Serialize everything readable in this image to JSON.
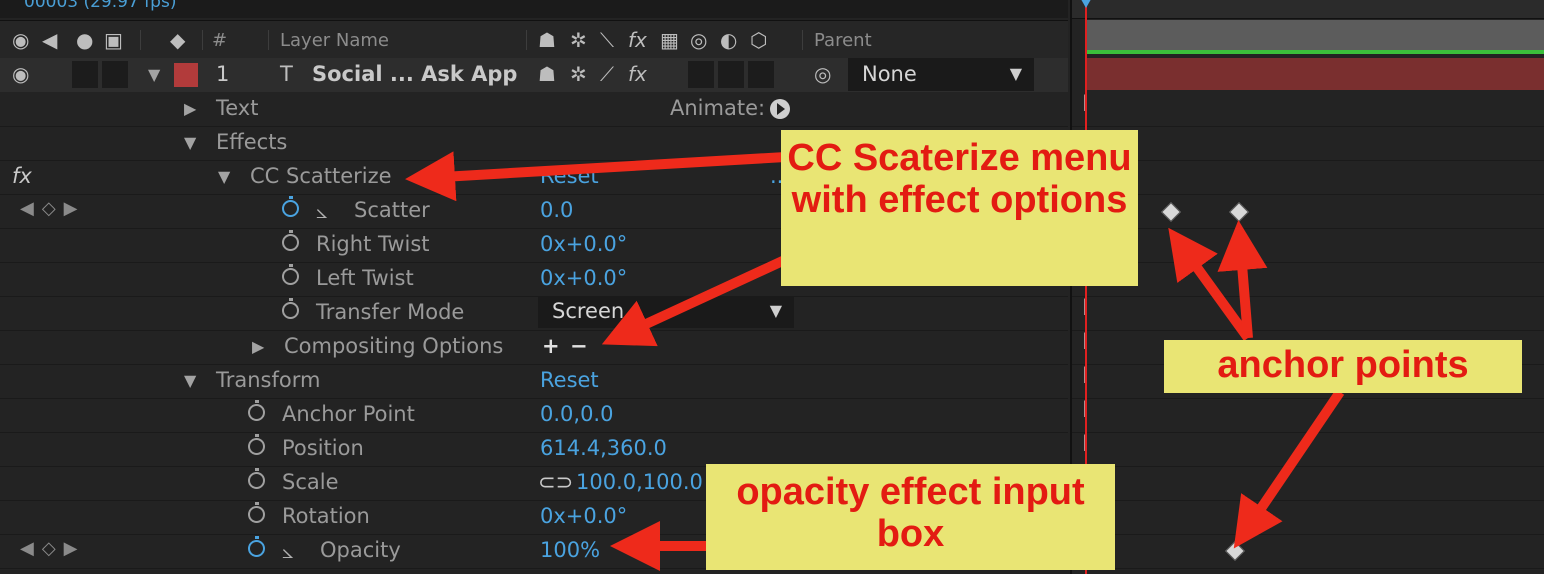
{
  "topbar": {
    "fps": "00003 (29.97 fps)"
  },
  "header": {
    "num_label": "#",
    "layer_name_label": "Layer Name",
    "parent_label": "Parent"
  },
  "layer": {
    "index": "1",
    "name": "Social ... Ask App",
    "color": "#b23b3b",
    "parent_value": "None"
  },
  "properties": {
    "text": "Text",
    "animate_label": "Animate:",
    "effects": "Effects",
    "fx_badge": "fx",
    "cc_scatterize": "CC Scatterize",
    "cc_reset": "Reset",
    "cc_more": "...",
    "scatter": {
      "label": "Scatter",
      "value": "0.0"
    },
    "right_twist": {
      "label": "Right Twist",
      "value": "0x+0.0°"
    },
    "left_twist": {
      "label": "Left Twist",
      "value": "0x+0.0°"
    },
    "transfer_mode": {
      "label": "Transfer Mode",
      "value": "Screen"
    },
    "compositing": {
      "label": "Compositing Options",
      "plus": "+",
      "minus": "−"
    },
    "transform": {
      "label": "Transform",
      "reset": "Reset"
    },
    "anchor_point": {
      "label": "Anchor Point",
      "value": "0.0,0.0"
    },
    "position": {
      "label": "Position",
      "value": "614.4,360.0"
    },
    "scale": {
      "label": "Scale",
      "value": "100.0,100.0"
    },
    "rotation": {
      "label": "Rotation",
      "value": "0x+0.0°"
    },
    "opacity": {
      "label": "Opacity",
      "value": "100%"
    }
  },
  "annotations": {
    "cc_callout": "CC Scaterize menu with effect options",
    "anchor_callout": "anchor points",
    "opacity_callout": "opacity effect input box",
    "callout_bg": "#e9e574",
    "callout_text_color": "#e31b12",
    "arrow_color": "#ee2a1b"
  },
  "colors": {
    "value_blue": "#4aa3e0",
    "panel_bg": "#232323",
    "playhead": "#e02020"
  }
}
